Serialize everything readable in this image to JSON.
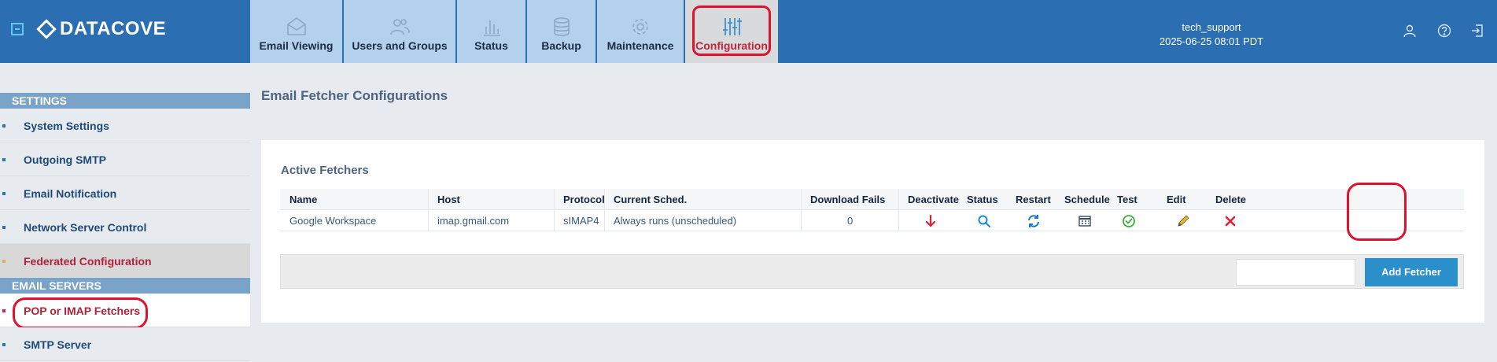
{
  "header": {
    "brand": "DATACOVE",
    "tabs": [
      {
        "label": "Email Viewing",
        "icon": "envelope-icon"
      },
      {
        "label": "Users and Groups",
        "icon": "users-icon"
      },
      {
        "label": "Status",
        "icon": "bar-chart-icon"
      },
      {
        "label": "Backup",
        "icon": "database-icon"
      },
      {
        "label": "Maintenance",
        "icon": "gear-icon"
      },
      {
        "label": "Configuration",
        "icon": "sliders-icon",
        "active": true
      }
    ],
    "username": "tech_support",
    "datetime": "2025-06-25 08:01 PDT",
    "icons": [
      "user-icon",
      "help-icon",
      "logout-icon"
    ]
  },
  "sidebar": {
    "settings_header": "SETTINGS",
    "settings_items": [
      {
        "label": "System Settings"
      },
      {
        "label": "Outgoing SMTP"
      },
      {
        "label": "Email Notification"
      },
      {
        "label": "Network Server Control"
      },
      {
        "label": "Federated Configuration"
      }
    ],
    "email_servers_header": "EMAIL SERVERS",
    "email_server_items": [
      {
        "label": "POP or IMAP Fetchers",
        "selected": true
      },
      {
        "label": "SMTP Server"
      }
    ]
  },
  "main": {
    "title": "Email Fetcher Configurations",
    "active_title": "Active Fetchers",
    "columns": [
      "Name",
      "Host",
      "Protocol",
      "Current Sched.",
      "Download Fails",
      "Deactivate",
      "Status",
      "Restart",
      "Schedule",
      "Test",
      "Edit",
      "Delete"
    ],
    "rows": [
      {
        "name": "Google Workspace",
        "host": "imap.gmail.com",
        "protocol": "sIMAP4",
        "schedule": "Always runs (unscheduled)",
        "download_fails": "0"
      }
    ],
    "add_fetcher_label": "Add Fetcher",
    "fetcher_input_value": ""
  },
  "colors": {
    "topbar": "#2b6fb2",
    "tab": "#b3d1ec",
    "active_tab": "#d8dadc",
    "accent_red": "#e0112f",
    "button": "#2a8fcb"
  }
}
